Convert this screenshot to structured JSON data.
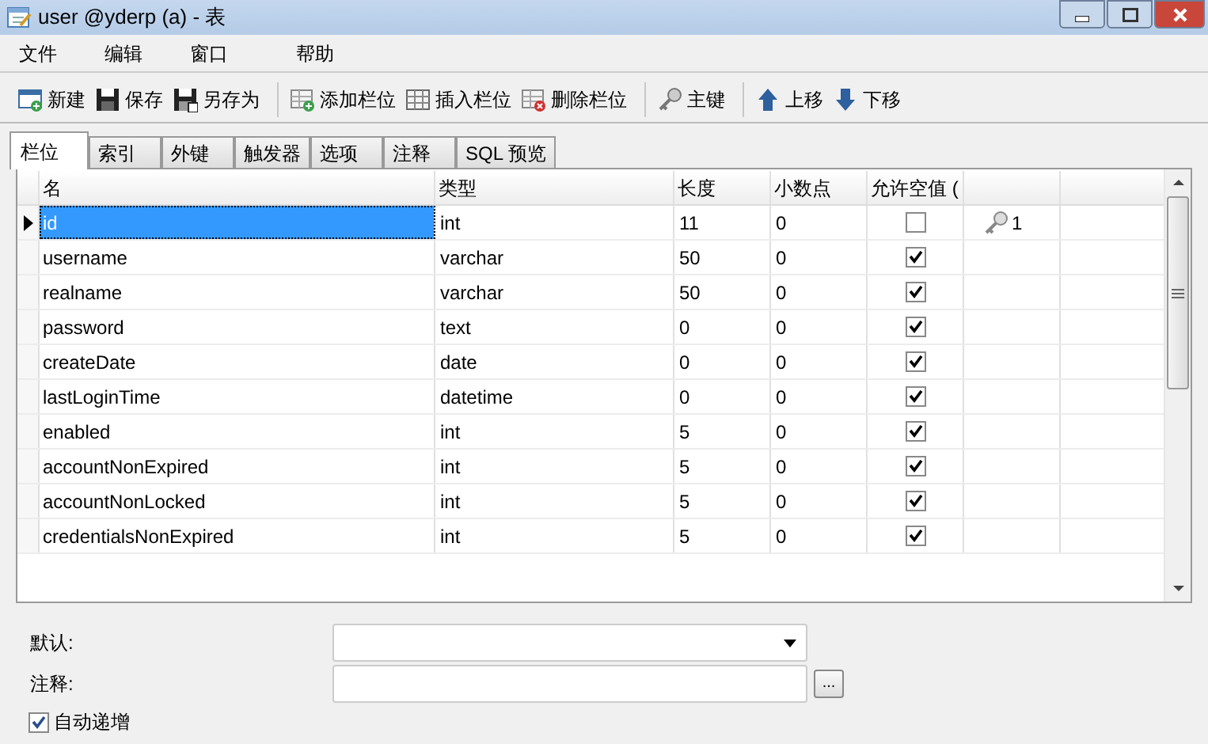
{
  "window": {
    "title": "user @yderp (a) - 表"
  },
  "menu": [
    "文件",
    "编辑",
    "窗口",
    "帮助"
  ],
  "toolbar": [
    {
      "kind": "new",
      "label": "新建"
    },
    {
      "kind": "save",
      "label": "保存"
    },
    {
      "kind": "saveas",
      "label": "另存为"
    },
    {
      "kind": "sep"
    },
    {
      "kind": "addcol",
      "label": "添加栏位"
    },
    {
      "kind": "inscol",
      "label": "插入栏位"
    },
    {
      "kind": "delcol",
      "label": "删除栏位"
    },
    {
      "kind": "sep"
    },
    {
      "kind": "key",
      "label": "主键"
    },
    {
      "kind": "sep"
    },
    {
      "kind": "up",
      "label": "上移"
    },
    {
      "kind": "down",
      "label": "下移"
    }
  ],
  "tabs": [
    {
      "label": "栏位",
      "selected": true
    },
    {
      "label": "索引",
      "selected": false
    },
    {
      "label": "外键",
      "selected": false
    },
    {
      "label": "触发器",
      "selected": false
    },
    {
      "label": "选项",
      "selected": false
    },
    {
      "label": "注释",
      "selected": false
    },
    {
      "label": "SQL 预览",
      "selected": false
    }
  ],
  "table": {
    "columns": [
      "名",
      "类型",
      "长度",
      "小数点",
      "允许空值 ("
    ],
    "rows": [
      {
        "name": "id",
        "type": "int",
        "length": "11",
        "decimals": "0",
        "nullable": false,
        "key": "1",
        "selected": true
      },
      {
        "name": "username",
        "type": "varchar",
        "length": "50",
        "decimals": "0",
        "nullable": true,
        "selected": false
      },
      {
        "name": "realname",
        "type": "varchar",
        "length": "50",
        "decimals": "0",
        "nullable": true,
        "selected": false
      },
      {
        "name": "password",
        "type": "text",
        "length": "0",
        "decimals": "0",
        "nullable": true,
        "selected": false
      },
      {
        "name": "createDate",
        "type": "date",
        "length": "0",
        "decimals": "0",
        "nullable": true,
        "selected": false
      },
      {
        "name": "lastLoginTime",
        "type": "datetime",
        "length": "0",
        "decimals": "0",
        "nullable": true,
        "selected": false
      },
      {
        "name": "enabled",
        "type": "int",
        "length": "5",
        "decimals": "0",
        "nullable": true,
        "selected": false
      },
      {
        "name": "accountNonExpired",
        "type": "int",
        "length": "5",
        "decimals": "0",
        "nullable": true,
        "selected": false
      },
      {
        "name": "accountNonLocked",
        "type": "int",
        "length": "5",
        "decimals": "0",
        "nullable": true,
        "selected": false
      },
      {
        "name": "credentialsNonExpired",
        "type": "int",
        "length": "5",
        "decimals": "0",
        "nullable": true,
        "selected": false
      }
    ]
  },
  "properties": {
    "default_label": "默认:",
    "comment_label": "注释:",
    "comment_button": "...",
    "auto_increment": {
      "label": "自动递增",
      "checked": true
    }
  }
}
